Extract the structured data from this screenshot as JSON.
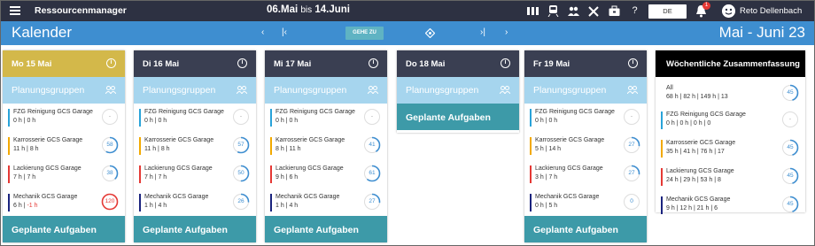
{
  "topbar": {
    "app_title": "Ressourcenmanager",
    "date_from": "06.Mai",
    "date_sep": "bis",
    "date_to": "14.Juni",
    "language": "DE",
    "notification_count": "1",
    "user_name": "Reto Dellenbach",
    "icons": [
      "columns-icon",
      "train-icon",
      "people-icon",
      "tools-icon",
      "briefcase-icon",
      "help-icon"
    ]
  },
  "calbar": {
    "title": "Kalender",
    "goto_label": "GEHE ZU",
    "range_title": "Mai - Juni 23"
  },
  "labels": {
    "groups": "Planungsgruppen",
    "tasks": "Geplante Aufgaben"
  },
  "colors": {
    "topbar": "#2d3142",
    "calbar": "#3e8ed0",
    "today": "#d3b84a",
    "day_head": "#3a3f52",
    "groups": "#a6d5ee",
    "tasks": "#3d9aa8",
    "fzg": "#29a3d9",
    "karrosserie": "#f2a900",
    "lackierung": "#e53935",
    "mechanik": "#1a237e"
  },
  "days": [
    {
      "label": "Mo 15 Mai",
      "rows": [
        {
          "name": "FZG Reinigung GCS Garage",
          "vals": "0 h | 0 h",
          "neg": "",
          "ring": "-",
          "pct": 0
        },
        {
          "name": "Karrosserie GCS Garage",
          "vals": "11 h | 8 h",
          "neg": "",
          "ring": "58",
          "pct": 58
        },
        {
          "name": "Lackierung GCS Garage",
          "vals": "7 h | 7 h",
          "neg": "",
          "ring": "38",
          "pct": 38
        },
        {
          "name": "Mechanik GCS Garage",
          "vals": "6 h | ",
          "neg": "-1 h",
          "ring": "120",
          "pct": 100
        }
      ]
    },
    {
      "label": "Di 16 Mai",
      "rows": [
        {
          "name": "FZG Reinigung GCS Garage",
          "vals": "0 h | 0 h",
          "neg": "",
          "ring": "-",
          "pct": 0
        },
        {
          "name": "Karrosserie GCS Garage",
          "vals": "11 h | 8 h",
          "neg": "",
          "ring": "57",
          "pct": 57
        },
        {
          "name": "Lackierung GCS Garage",
          "vals": "7 h | 7 h",
          "neg": "",
          "ring": "50",
          "pct": 50
        },
        {
          "name": "Mechanik GCS Garage",
          "vals": "1 h | 4 h",
          "neg": "",
          "ring": "26",
          "pct": 26
        }
      ]
    },
    {
      "label": "Mi 17 Mai",
      "rows": [
        {
          "name": "FZG Reinigung GCS Garage",
          "vals": "0 h | 0 h",
          "neg": "",
          "ring": "-",
          "pct": 0
        },
        {
          "name": "Karrosserie GCS Garage",
          "vals": "8 h | 11 h",
          "neg": "",
          "ring": "41",
          "pct": 41
        },
        {
          "name": "Lackierung GCS Garage",
          "vals": "9 h | 6 h",
          "neg": "",
          "ring": "61",
          "pct": 61
        },
        {
          "name": "Mechanik GCS Garage",
          "vals": "1 h | 4 h",
          "neg": "",
          "ring": "27",
          "pct": 27
        }
      ]
    },
    {
      "label": "Do 18 Mai",
      "rows": []
    },
    {
      "label": "Fr 19 Mai",
      "rows": [
        {
          "name": "FZG Reinigung GCS Garage",
          "vals": "0 h | 0 h",
          "neg": "",
          "ring": "-",
          "pct": 0
        },
        {
          "name": "Karrosserie GCS Garage",
          "vals": "5 h | 14 h",
          "neg": "",
          "ring": "27",
          "pct": 27
        },
        {
          "name": "Lackierung GCS Garage",
          "vals": "3 h | 7 h",
          "neg": "",
          "ring": "27",
          "pct": 27
        },
        {
          "name": "Mechanik GCS Garage",
          "vals": "0 h | 5 h",
          "neg": "",
          "ring": "0",
          "pct": 0
        }
      ]
    }
  ],
  "weekly": {
    "title": "Wöchentliche Zusammenfassung",
    "all": {
      "name": "All",
      "vals": "68 h | 82 h | 149 h | 13",
      "ring": "45",
      "pct": 45
    },
    "rows": [
      {
        "name": "FZG Reinigung GCS Garage",
        "vals": "0 h | 0 h | 0 h | 0",
        "ring": "-",
        "pct": 0
      },
      {
        "name": "Karrosserie GCS Garage",
        "vals": "35 h | 41 h | 76 h | 17",
        "ring": "45",
        "pct": 45
      },
      {
        "name": "Lackierung GCS Garage",
        "vals": "24 h | 29 h | 53 h | 8",
        "ring": "45",
        "pct": 45
      },
      {
        "name": "Mechanik GCS Garage",
        "vals": "9 h | 12 h | 21 h | 6",
        "ring": "45",
        "pct": 45
      }
    ]
  }
}
